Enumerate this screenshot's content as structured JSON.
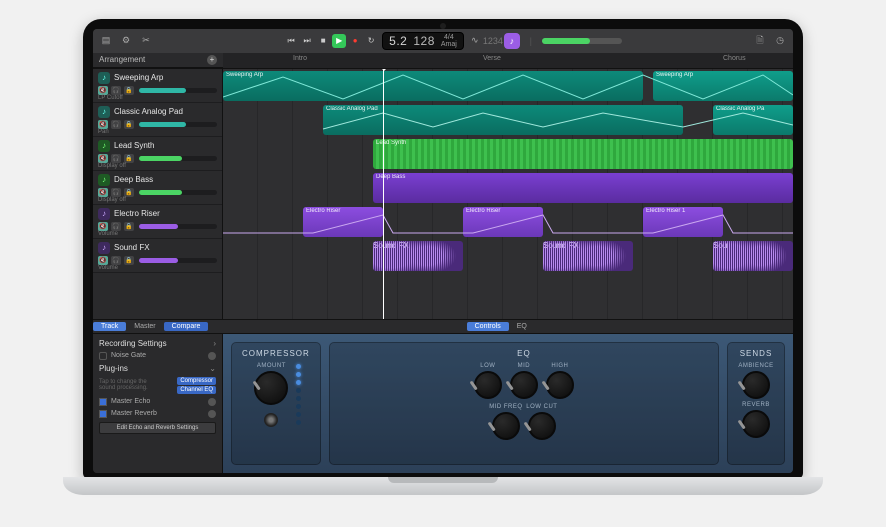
{
  "toolbar": {
    "position": "5.2",
    "tempo": "128",
    "sig_top": "4/4",
    "sig_bot": "Amaj",
    "key_pill": "♪",
    "marker": "—"
  },
  "ruler": {
    "title": "Arrangement",
    "markers": {
      "a": "Intro",
      "b": "Verse",
      "c": "Chorus"
    }
  },
  "tracks": [
    {
      "name": "Sweeping Arp",
      "sub": "LP Cutoff",
      "color": "teal"
    },
    {
      "name": "Classic Analog Pad",
      "sub": "Pan",
      "color": "teal"
    },
    {
      "name": "Lead Synth",
      "sub": "Display off",
      "color": "green"
    },
    {
      "name": "Deep Bass",
      "sub": "Display off",
      "color": "green"
    },
    {
      "name": "Electro Riser",
      "sub": "Volume",
      "color": "purple"
    },
    {
      "name": "Sound FX",
      "sub": "Volume",
      "color": "purple"
    }
  ],
  "regions": {
    "r0a": "Sweeping Arp",
    "r0b": "Sweeping Arp",
    "r1a": "Classic Analog Pad",
    "r1b": "Classic Analog Pa",
    "r2a": "Lead Synth",
    "r3a": "Deep Bass",
    "r4a": "Electro Riser",
    "r4b": "Electro Riser",
    "r4c": "Electro Riser 1",
    "r5a": "Sound FX",
    "r5b": "Sound FX",
    "r5c": "Sou"
  },
  "tabbar": {
    "track": "Track",
    "master": "Master",
    "compare": "Compare",
    "controls": "Controls",
    "eq": "EQ"
  },
  "inspector": {
    "rec": "Recording Settings",
    "noise": "Noise Gate",
    "plugins": "Plug-ins",
    "hint": "Tap to change the sound processing.",
    "tag1": "Compressor",
    "tag2": "Channel EQ",
    "mecho": "Master Echo",
    "mrev": "Master Reverb",
    "editbtn": "Edit Echo and Reverb Settings"
  },
  "fx": {
    "comp": "COMPRESSOR",
    "amount": "AMOUNT",
    "eq": "EQ",
    "low": "LOW",
    "mid": "MID",
    "high": "HIGH",
    "midf": "MID FREQ",
    "lowcut": "LOW CUT",
    "sends": "SENDS",
    "amb": "AMBIENCE",
    "rev": "REVERB"
  }
}
